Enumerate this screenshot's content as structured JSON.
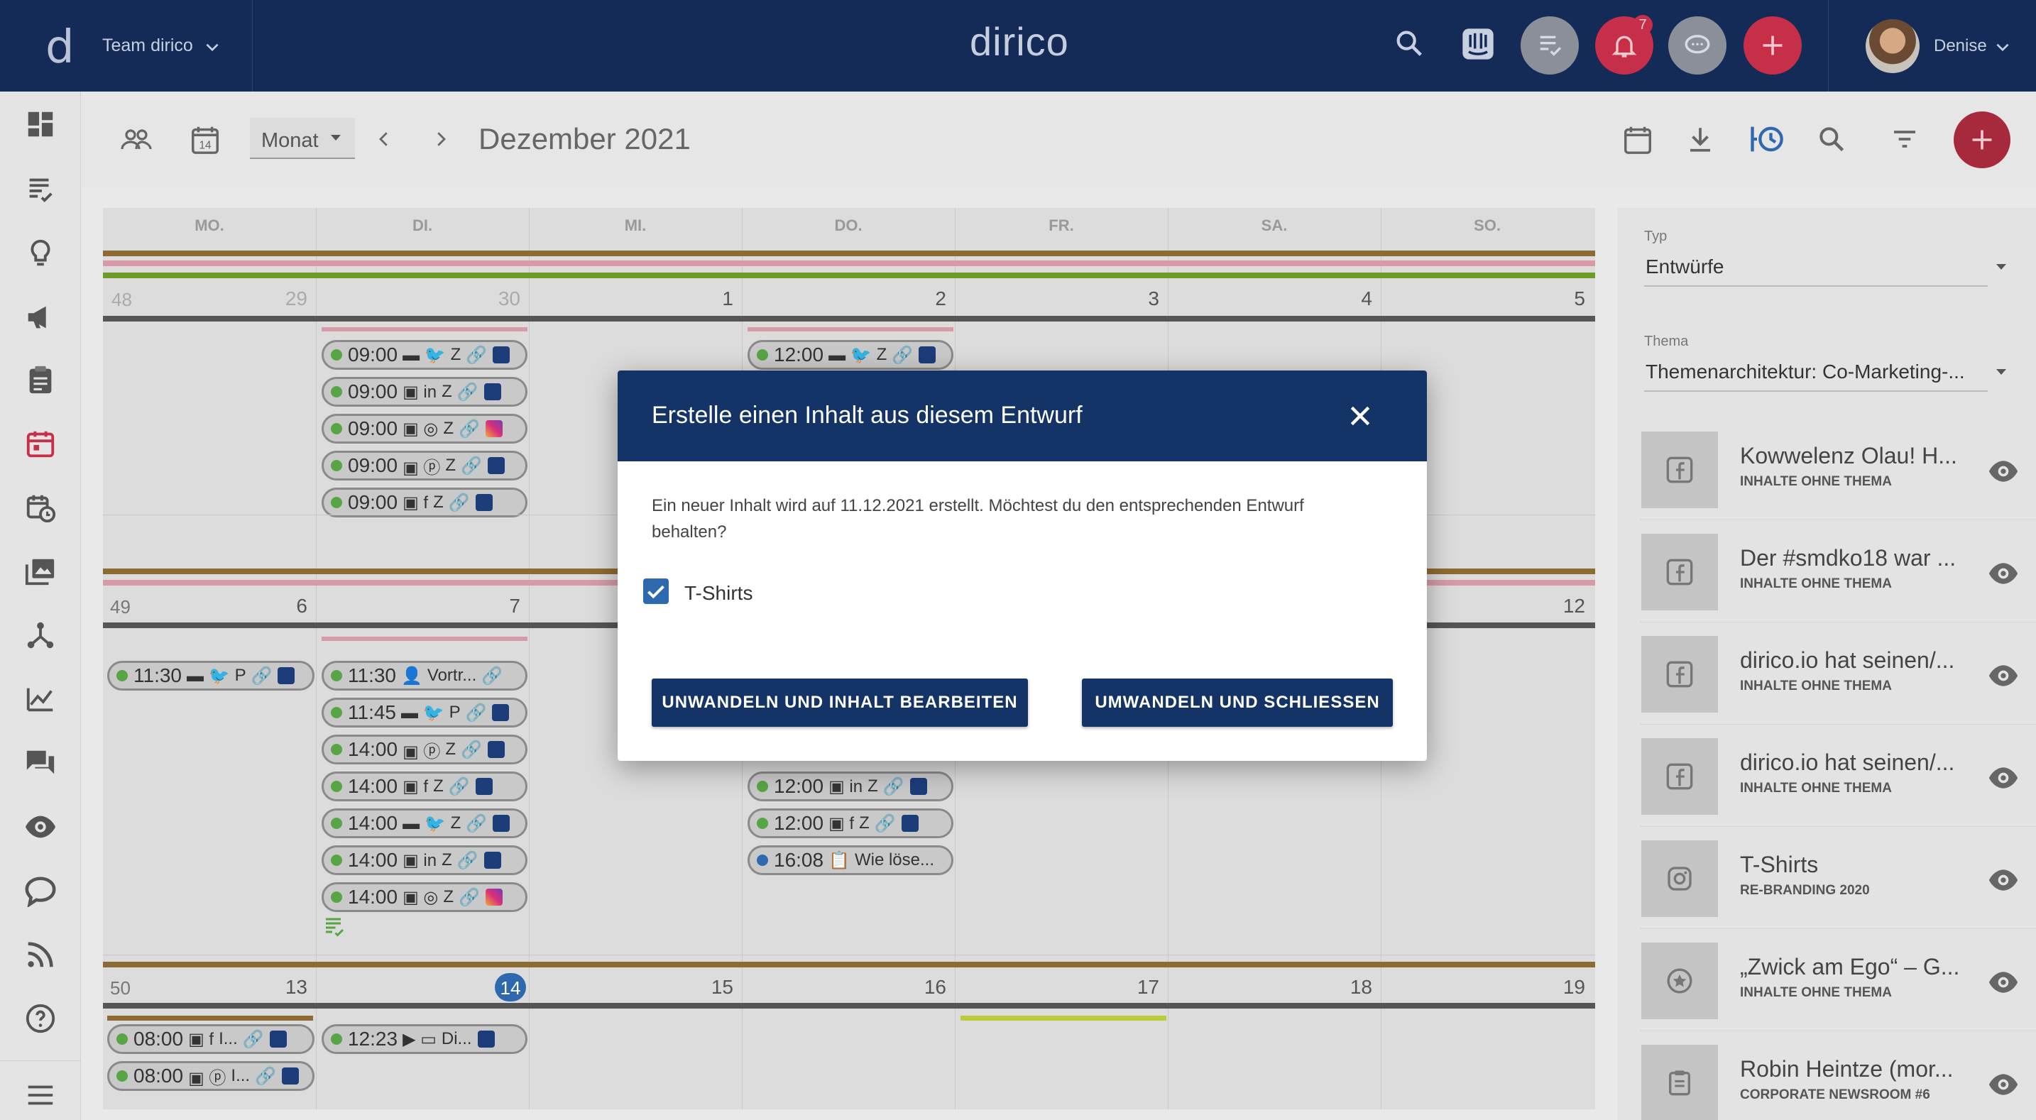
{
  "header": {
    "logo_letter": "d",
    "team": "Team dirico",
    "brand": "dirico",
    "notifications_count": "7",
    "user_name": "Denise"
  },
  "toolbar": {
    "view_select": "Monat",
    "month_title": "Dezember 2021"
  },
  "calendar": {
    "weekdays": [
      "MO.",
      "DI.",
      "MI.",
      "DO.",
      "FR.",
      "SA.",
      "SO."
    ],
    "weeks": [
      {
        "number": "48",
        "days": [
          "29",
          "30",
          "1",
          "2",
          "3",
          "4",
          "5"
        ]
      },
      {
        "number": "49",
        "days": [
          "6",
          "7",
          "12"
        ]
      },
      {
        "number": "50",
        "days": [
          "13",
          "14",
          "15",
          "16",
          "17",
          "18",
          "19"
        ]
      }
    ],
    "events": {
      "tue_w1": [
        "09:00",
        "09:00",
        "09:00",
        "09:00",
        "09:00"
      ],
      "thu_w1": [
        "12:00"
      ],
      "mon_w2": [
        {
          "time": "11:30",
          "label": "P"
        }
      ],
      "tue_w2": [
        {
          "time": "11:30",
          "label": "Vortr..."
        },
        {
          "time": "11:45",
          "label": "P"
        },
        {
          "time": "14:00",
          "label": "Z"
        },
        {
          "time": "14:00",
          "label": "Z"
        },
        {
          "time": "14:00",
          "label": "Z"
        },
        {
          "time": "14:00",
          "label": "Z"
        },
        {
          "time": "14:00",
          "label": "Z"
        }
      ],
      "thu_w2": [
        {
          "time": "12:00",
          "label": "Z"
        },
        {
          "time": "12:00",
          "label": "Z"
        },
        {
          "time": "16:08",
          "label": "Wie löse..."
        }
      ],
      "mon_w3": [
        {
          "time": "08:00",
          "label": "I..."
        },
        {
          "time": "08:00",
          "label": "I..."
        }
      ],
      "tue_w3": [
        {
          "time": "12:23",
          "label": "Di..."
        }
      ],
      "z_label": "Z"
    }
  },
  "right_panel": {
    "type_label": "Typ",
    "type_value": "Entwürfe",
    "theme_label": "Thema",
    "theme_value": "Themenarchitektur: Co-Marketing-...",
    "items": [
      {
        "title": "Kowwelenz Olau! H...",
        "subtitle": "INHALTE OHNE THEMA",
        "icon": "facebook-icon"
      },
      {
        "title": "Der #smdko18 war ...",
        "subtitle": "INHALTE OHNE THEMA",
        "icon": "facebook-icon"
      },
      {
        "title": "dirico.io hat seinen/...",
        "subtitle": "INHALTE OHNE THEMA",
        "icon": "facebook-icon"
      },
      {
        "title": "dirico.io hat seinen/...",
        "subtitle": "INHALTE OHNE THEMA",
        "icon": "facebook-icon"
      },
      {
        "title": "T-Shirts",
        "subtitle": "RE-BRANDING 2020",
        "icon": "instagram-icon"
      },
      {
        "title": "„Zwick am Ego“ – G...",
        "subtitle": "INHALTE OHNE THEMA",
        "icon": "star-icon"
      },
      {
        "title": "Robin Heintze (mor...",
        "subtitle": "CORPORATE NEWSROOM #6",
        "icon": "clipboard-icon"
      }
    ]
  },
  "dialog": {
    "title": "Erstelle einen Inhalt aus diesem Entwurf",
    "message": "Ein neuer Inhalt wird auf 11.12.2021 erstellt. Möchtest du den entsprechenden Entwurf behalten?",
    "checkbox_label": "T-Shirts",
    "checkbox_checked": true,
    "button_edit": "UNWANDELN UND INHALT BEARBEITEN",
    "button_close": "UMWANDELN UND SCHLIESSEN"
  },
  "colors": {
    "header_bg": "#142a57",
    "accent_red": "#c62f47",
    "dialog_header": "#143366",
    "event_green": "#57a545"
  }
}
